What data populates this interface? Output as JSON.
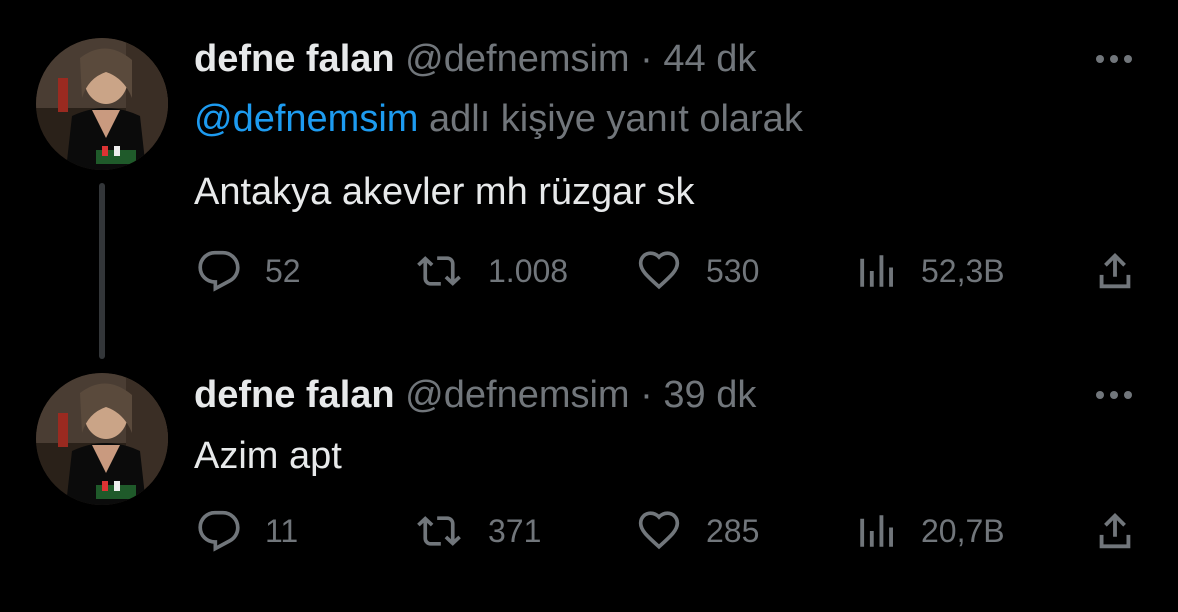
{
  "colors": {
    "background": "#000000",
    "text_primary": "#e7e9ea",
    "text_secondary": "#71767b",
    "link": "#1d9bf0",
    "thread_line": "#333639"
  },
  "tweets": [
    {
      "author_name": "defne falan",
      "handle": "@defnemsim",
      "separator": "·",
      "time": "44 dk",
      "reply_to": {
        "mention": "@defnemsim",
        "suffix": " adlı kişiye yanıt olarak"
      },
      "text": "Antakya akevler mh rüzgar sk",
      "actions": {
        "reply": {
          "icon": "reply-icon",
          "count": "52"
        },
        "retweet": {
          "icon": "retweet-icon",
          "count": "1.008"
        },
        "like": {
          "icon": "heart-icon",
          "count": "530"
        },
        "views": {
          "icon": "views-icon",
          "count": "52,3B"
        },
        "share": {
          "icon": "share-icon"
        }
      }
    },
    {
      "author_name": "defne falan",
      "handle": "@defnemsim",
      "separator": "·",
      "time": "39 dk",
      "text": "Azim apt",
      "actions": {
        "reply": {
          "icon": "reply-icon",
          "count": "11"
        },
        "retweet": {
          "icon": "retweet-icon",
          "count": "371"
        },
        "like": {
          "icon": "heart-icon",
          "count": "285"
        },
        "views": {
          "icon": "views-icon",
          "count": "20,7B"
        },
        "share": {
          "icon": "share-icon"
        }
      }
    }
  ]
}
